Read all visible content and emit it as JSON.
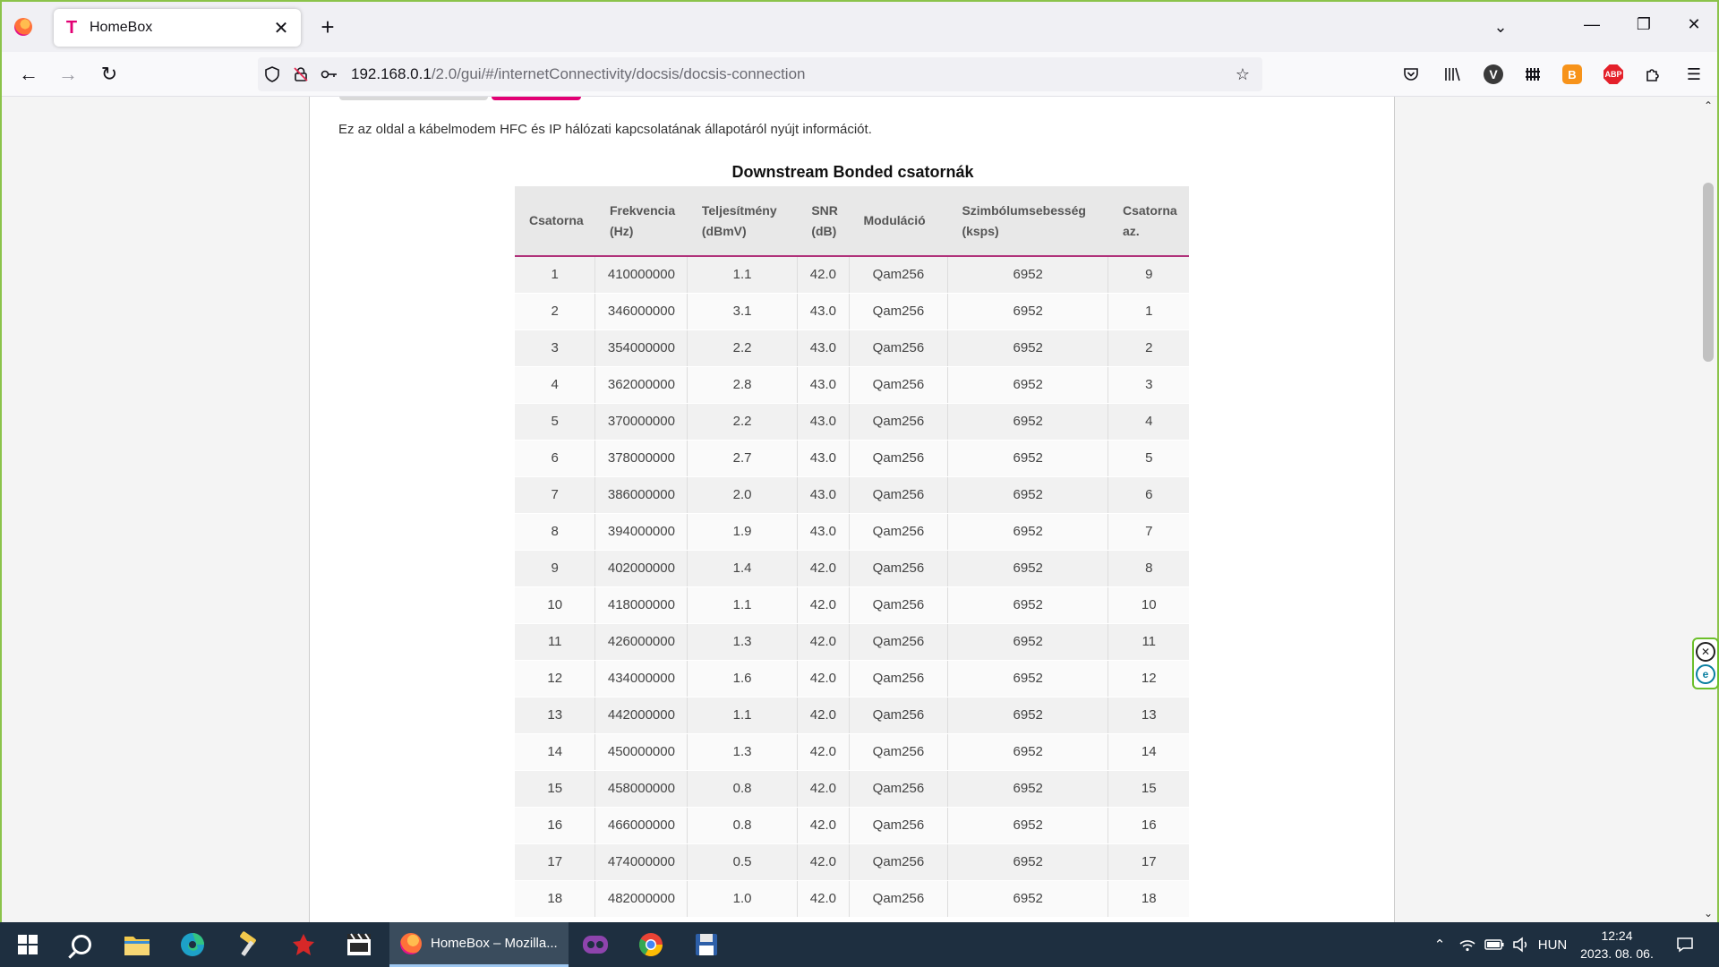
{
  "browser": {
    "tab_title": "HomeBox",
    "tab_favicon": "T",
    "url_host": "192.168.0.1",
    "url_path": "/2.0/gui/#/internetConnectivity/docsis/docsis-connection",
    "window_controls": {
      "minimize": "—",
      "maximize": "❐",
      "close": "✕"
    },
    "nav": {
      "back": "←",
      "forward": "→",
      "reload": "↻"
    },
    "extensions": {
      "vivaldi": "V",
      "brave": "B",
      "adblock": "ABP"
    }
  },
  "page": {
    "intro": "Ez az oldal a kábelmodem HFC és IP hálózati kapcsolatának állapotáról nyújt információt.",
    "table_title": "Downstream Bonded csatornák",
    "columns": [
      [
        "Csatorna",
        ""
      ],
      [
        "Frekvencia",
        "(Hz)"
      ],
      [
        "Teljesítmény",
        "(dBmV)"
      ],
      [
        "SNR",
        "(dB)"
      ],
      [
        "Moduláció",
        ""
      ],
      [
        "Szimbólumsebesség",
        "(ksps)"
      ],
      [
        "Csatorna",
        "az."
      ]
    ],
    "rows": [
      [
        "1",
        "410000000",
        "1.1",
        "42.0",
        "Qam256",
        "6952",
        "9"
      ],
      [
        "2",
        "346000000",
        "3.1",
        "43.0",
        "Qam256",
        "6952",
        "1"
      ],
      [
        "3",
        "354000000",
        "2.2",
        "43.0",
        "Qam256",
        "6952",
        "2"
      ],
      [
        "4",
        "362000000",
        "2.8",
        "43.0",
        "Qam256",
        "6952",
        "3"
      ],
      [
        "5",
        "370000000",
        "2.2",
        "43.0",
        "Qam256",
        "6952",
        "4"
      ],
      [
        "6",
        "378000000",
        "2.7",
        "43.0",
        "Qam256",
        "6952",
        "5"
      ],
      [
        "7",
        "386000000",
        "2.0",
        "43.0",
        "Qam256",
        "6952",
        "6"
      ],
      [
        "8",
        "394000000",
        "1.9",
        "43.0",
        "Qam256",
        "6952",
        "7"
      ],
      [
        "9",
        "402000000",
        "1.4",
        "42.0",
        "Qam256",
        "6952",
        "8"
      ],
      [
        "10",
        "418000000",
        "1.1",
        "42.0",
        "Qam256",
        "6952",
        "10"
      ],
      [
        "11",
        "426000000",
        "1.3",
        "42.0",
        "Qam256",
        "6952",
        "11"
      ],
      [
        "12",
        "434000000",
        "1.6",
        "42.0",
        "Qam256",
        "6952",
        "12"
      ],
      [
        "13",
        "442000000",
        "1.1",
        "42.0",
        "Qam256",
        "6952",
        "13"
      ],
      [
        "14",
        "450000000",
        "1.3",
        "42.0",
        "Qam256",
        "6952",
        "14"
      ],
      [
        "15",
        "458000000",
        "0.8",
        "42.0",
        "Qam256",
        "6952",
        "15"
      ],
      [
        "16",
        "466000000",
        "0.8",
        "42.0",
        "Qam256",
        "6952",
        "16"
      ],
      [
        "17",
        "474000000",
        "0.5",
        "42.0",
        "Qam256",
        "6952",
        "17"
      ],
      [
        "18",
        "482000000",
        "1.0",
        "42.0",
        "Qam256",
        "6952",
        "18"
      ]
    ]
  },
  "taskbar": {
    "active_window_title": "HomeBox – Mozilla...",
    "language": "HUN",
    "time": "12:24",
    "date": "2023. 08. 06."
  },
  "colors": {
    "brand_magenta": "#e20074",
    "window_border": "#8bc34a",
    "taskbar_bg": "#1e2f40"
  }
}
